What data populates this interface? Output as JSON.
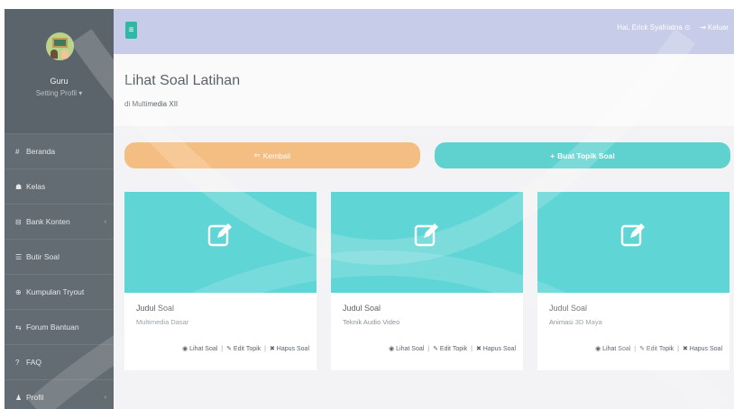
{
  "profile": {
    "name": "Guru",
    "setting": "Setting Profil ▾"
  },
  "menu": [
    {
      "icon": "home-icon",
      "glyph": "#",
      "label": "Beranda",
      "chevron": ""
    },
    {
      "icon": "graduation-cap-icon",
      "glyph": "☗",
      "label": "Kelas",
      "chevron": ""
    },
    {
      "icon": "stack-icon",
      "glyph": "⊟",
      "label": "Bank Konten",
      "chevron": "‹"
    },
    {
      "icon": "list-icon",
      "glyph": "☰",
      "label": "Butir Soal",
      "chevron": ""
    },
    {
      "icon": "layers-icon",
      "glyph": "⊕",
      "label": "Kumpulan Tryout",
      "chevron": ""
    },
    {
      "icon": "handshake-icon",
      "glyph": "⇆",
      "label": "Forum Bantuan",
      "chevron": ""
    },
    {
      "icon": "question-icon",
      "glyph": "?",
      "label": "FAQ",
      "chevron": ""
    },
    {
      "icon": "user-icon",
      "glyph": "♟",
      "label": "Profil",
      "chevron": "‹"
    }
  ],
  "header": {
    "greeting": "Hai, Erick Syafriatna ⊙",
    "logout": "⇥ Keluar",
    "toggle": "≡"
  },
  "page": {
    "title": "Lihat Soal Latihan",
    "subtitle": "di Multimedia XII"
  },
  "buttons": {
    "back": "Kembali",
    "back_icon": "⇐",
    "new": "Buat Topik Soal",
    "new_icon": "+"
  },
  "cards": [
    {
      "title": "Judul Soal",
      "subtitle": "Multimedia Dasar"
    },
    {
      "title": "Judul Soal",
      "subtitle": "Teknik Audio Video"
    },
    {
      "title": "Judul Soal",
      "subtitle": "Animasi 3D Maya"
    }
  ],
  "card_actions": {
    "view": "◉ Lihat Soal",
    "edit": "✎ Edit Topik",
    "delete": "✖ Hapus Soal",
    "sep": "|"
  },
  "colors": {
    "sidebar": "#636b73",
    "header": "#c7cde8",
    "teal": "#60d5d5",
    "orange": "#f4bd81",
    "accent": "#32b6a6"
  }
}
